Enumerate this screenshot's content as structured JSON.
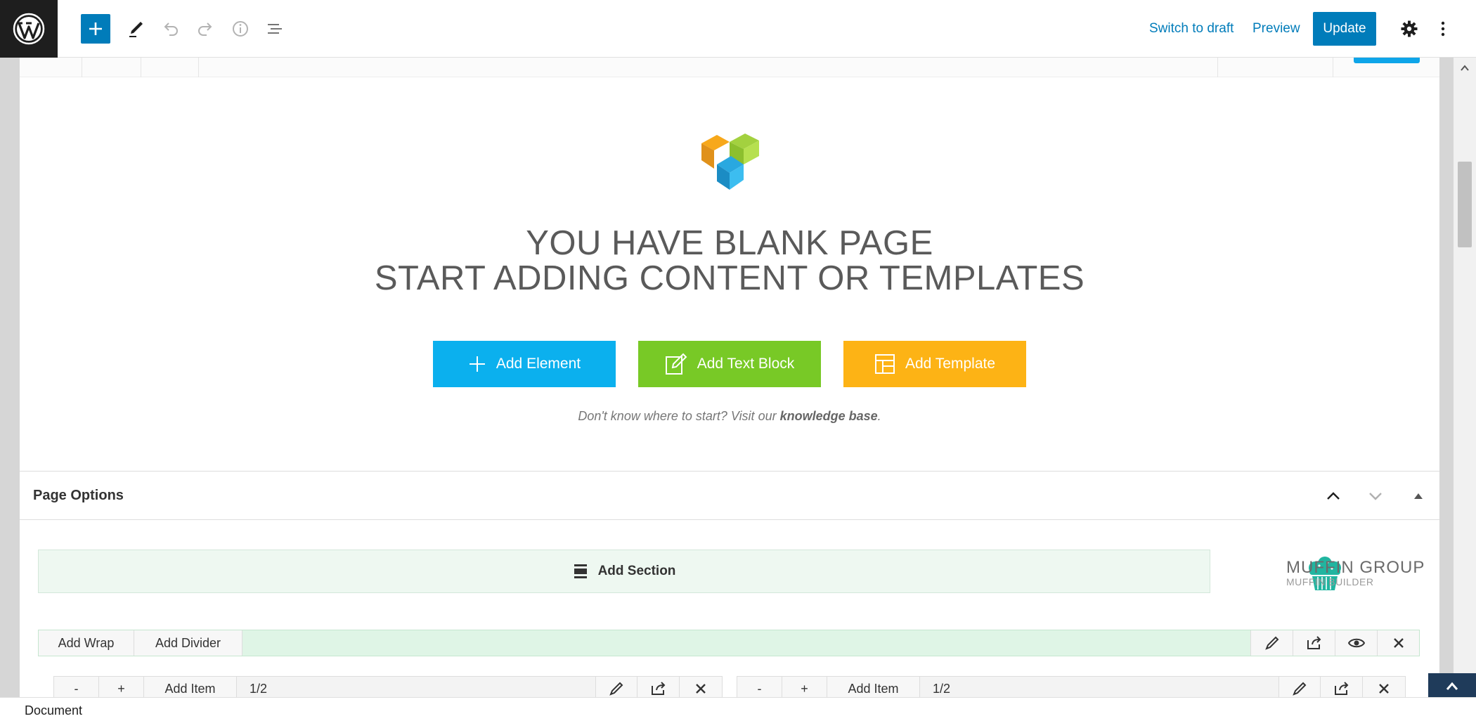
{
  "toolbar": {
    "switch_draft": "Switch to draft",
    "preview": "Preview",
    "update": "Update"
  },
  "blank": {
    "line1": "YOU HAVE BLANK PAGE",
    "line2": "START ADDING CONTENT OR TEMPLATES",
    "add_element": "Add Element",
    "add_text_block": "Add Text Block",
    "add_template": "Add Template",
    "help_prefix": "Don't know where to start? Visit our ",
    "help_link": "knowledge base",
    "help_suffix": "."
  },
  "page_options": {
    "title": "Page Options"
  },
  "muffin": {
    "add_section": "Add Section",
    "brand_name": "MUFFIN GROUP",
    "brand_sub": "MUFFIN BUILDER",
    "add_wrap": "Add Wrap",
    "add_divider": "Add Divider",
    "items": [
      {
        "minus": "-",
        "plus": "+",
        "add_item": "Add Item",
        "size": "1/2"
      },
      {
        "minus": "-",
        "plus": "+",
        "add_item": "Add Item",
        "size": "1/2"
      }
    ]
  },
  "footer": {
    "breadcrumb": "Document"
  },
  "colors": {
    "wp_blue": "#007cba",
    "add_element": "#0bb0ee",
    "add_text_block": "#78c926",
    "add_template": "#fdb315"
  }
}
